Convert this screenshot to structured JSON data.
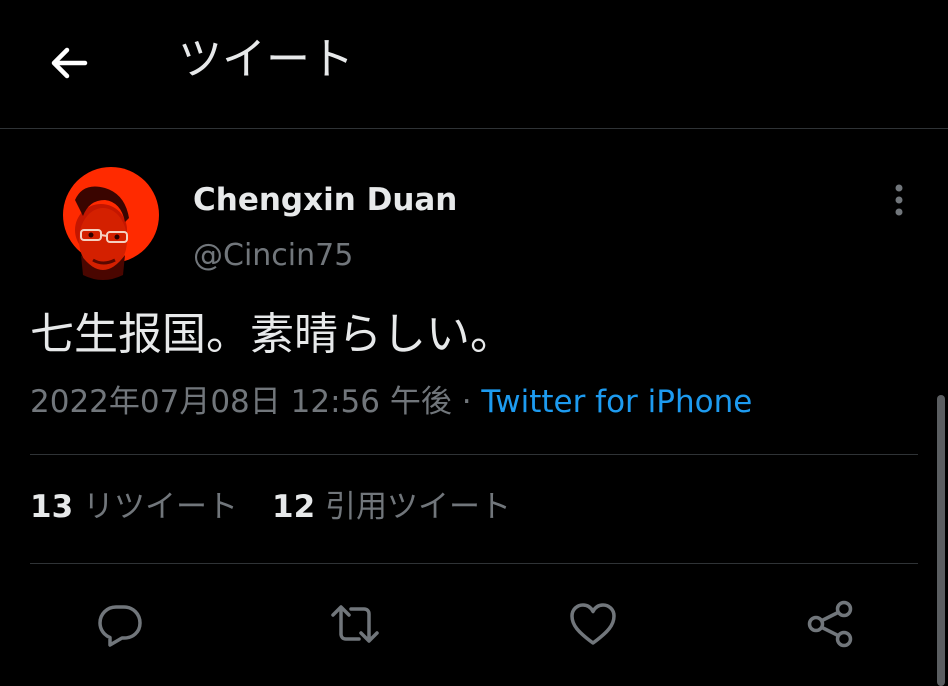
{
  "header": {
    "back_icon": "arrow-left-icon",
    "title": "ツイート"
  },
  "author": {
    "name": "Chengxin Duan",
    "handle": "@Cincin75",
    "avatar_accent": "#ff2a00"
  },
  "tweet": {
    "text": "七生报国。素晴らしい。",
    "datetime": "2022年07月08日 12:56 午後",
    "separator": "·",
    "source": "Twitter for iPhone"
  },
  "stats": {
    "retweets_count": "13",
    "retweets_label": "リツイート",
    "quotes_count": "12",
    "quotes_label": "引用ツイート"
  },
  "actions": [
    {
      "icon": "reply-icon"
    },
    {
      "icon": "retweet-icon"
    },
    {
      "icon": "like-icon"
    },
    {
      "icon": "share-icon"
    }
  ],
  "colors": {
    "background": "#000000",
    "text": "#e7e9ea",
    "secondary": "#71767b",
    "link": "#1d9bf0",
    "divider": "#2f3336"
  }
}
